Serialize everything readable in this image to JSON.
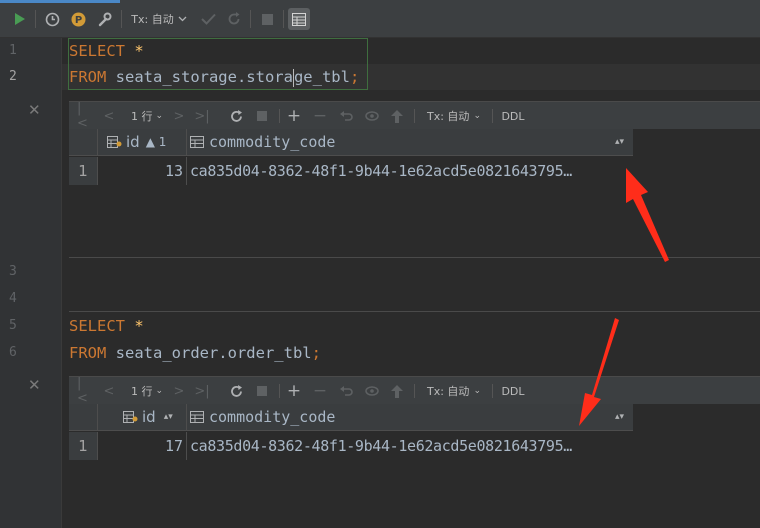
{
  "toolbar": {
    "tx_label": "Tx: 自动"
  },
  "editor": {
    "line_numbers": [
      "1",
      "2",
      "3",
      "4",
      "5",
      "6"
    ],
    "query1": {
      "line1": {
        "keyword": "SELECT",
        "star": "*"
      },
      "line2": {
        "keyword": "FROM",
        "pre_cursor": " seata_storage.stora",
        "post_cursor": "ge_tbl",
        "semicolon": ";"
      }
    },
    "query2": {
      "line1": {
        "keyword": "SELECT",
        "star": "*"
      },
      "line2": {
        "keyword": "FROM",
        "table": " seata_order.order_tbl",
        "semicolon": ";"
      }
    }
  },
  "results": [
    {
      "rows_label": "1 行",
      "tx_label": "Tx: 自动",
      "ddl_label": "DDL",
      "columns": [
        {
          "name": "id",
          "sort": "▲ 1"
        },
        {
          "name": "commodity_code",
          "sort": ""
        }
      ],
      "rows": [
        {
          "num": "1",
          "id": "13",
          "commodity_code": "ca835d04-8362-48f1-9b44-1e62acd5e0821643795…"
        }
      ]
    },
    {
      "rows_label": "1 行",
      "tx_label": "Tx: 自动",
      "ddl_label": "DDL",
      "columns": [
        {
          "name": "id",
          "sort": ""
        },
        {
          "name": "commodity_code",
          "sort": ""
        }
      ],
      "rows": [
        {
          "num": "1",
          "id": "17",
          "commodity_code": "ca835d04-8362-48f1-9b44-1e62acd5e0821643795…"
        }
      ]
    }
  ],
  "annotation_colors": {
    "arrow": "#ff2d1a"
  },
  "colors": {
    "keyword": "#cc7832",
    "star": "#ffc66d",
    "identifier": "#a9b7c6",
    "run_green": "#499c54",
    "accent": "#4a88c7"
  }
}
